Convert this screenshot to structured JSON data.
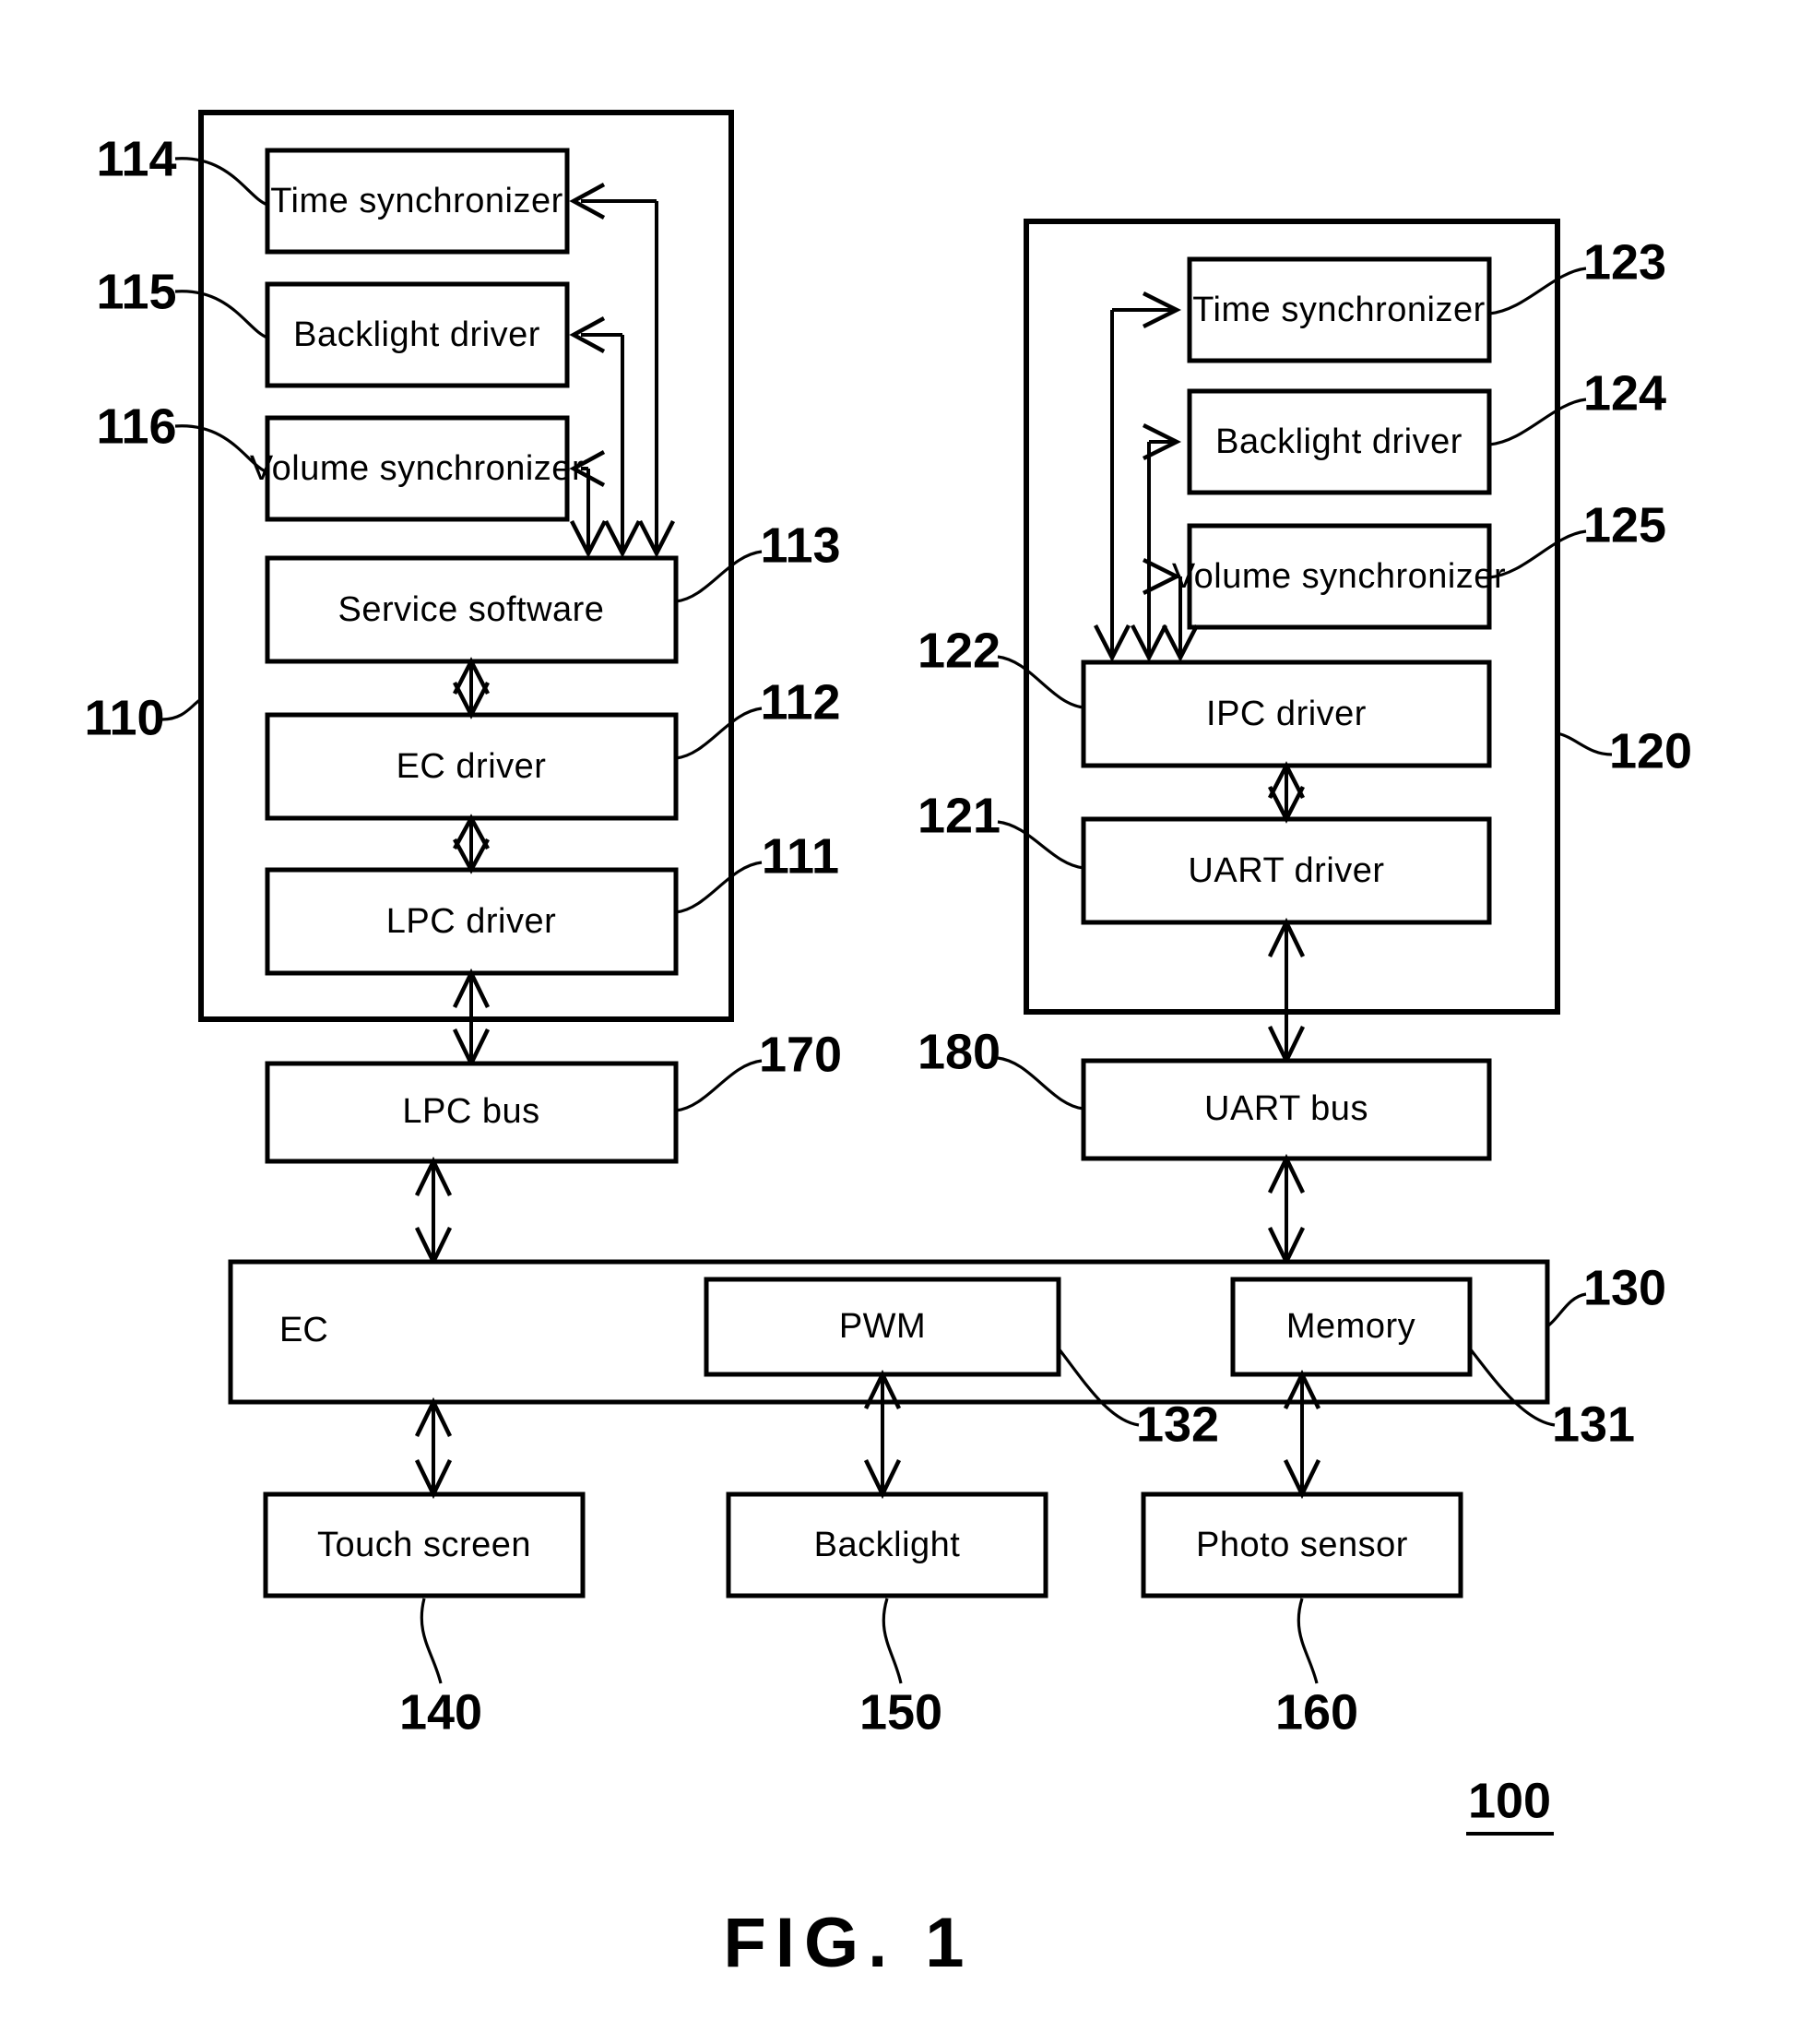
{
  "figure": {
    "caption": "FIG. 1",
    "system_ref": "100"
  },
  "containers": {
    "host_software": {
      "ref": "110"
    },
    "embedded_software": {
      "ref": "120"
    },
    "ec_chip": {
      "ref": "130"
    }
  },
  "blocks": {
    "left": [
      {
        "id": "time-synchronizer-110",
        "label": "Time synchronizer",
        "ref": "114"
      },
      {
        "id": "backlight-driver-110",
        "label": "Backlight driver",
        "ref": "115"
      },
      {
        "id": "volume-synchronizer-110",
        "label": "Volume synchronizer",
        "ref": "116"
      },
      {
        "id": "service-software",
        "label": "Service software",
        "ref": "113"
      },
      {
        "id": "ec-driver",
        "label": "EC driver",
        "ref": "112"
      },
      {
        "id": "lpc-driver",
        "label": "LPC driver",
        "ref": "111"
      }
    ],
    "right": [
      {
        "id": "time-synchronizer-120",
        "label": "Time synchronizer",
        "ref": "123"
      },
      {
        "id": "backlight-driver-120",
        "label": "Backlight driver",
        "ref": "124"
      },
      {
        "id": "volume-synchronizer-120",
        "label": "Volume synchronizer",
        "ref": "125"
      },
      {
        "id": "ipc-driver",
        "label": "IPC driver",
        "ref": "122"
      },
      {
        "id": "uart-driver",
        "label": "UART driver",
        "ref": "121"
      }
    ],
    "buses": [
      {
        "id": "lpc-bus",
        "label": "LPC bus",
        "ref": "170"
      },
      {
        "id": "uart-bus",
        "label": "UART bus",
        "ref": "180"
      }
    ],
    "ec": [
      {
        "id": "ec",
        "label": "EC",
        "ref": "130"
      },
      {
        "id": "pwm",
        "label": "PWM",
        "ref": "132"
      },
      {
        "id": "memory",
        "label": "Memory",
        "ref": "131"
      }
    ],
    "peripherals": [
      {
        "id": "touch-screen",
        "label": "Touch screen",
        "ref": "140"
      },
      {
        "id": "backlight",
        "label": "Backlight",
        "ref": "150"
      },
      {
        "id": "photo-sensor",
        "label": "Photo sensor",
        "ref": "160"
      }
    ]
  },
  "colors": {
    "ink": "#000000",
    "paper": "#ffffff"
  }
}
